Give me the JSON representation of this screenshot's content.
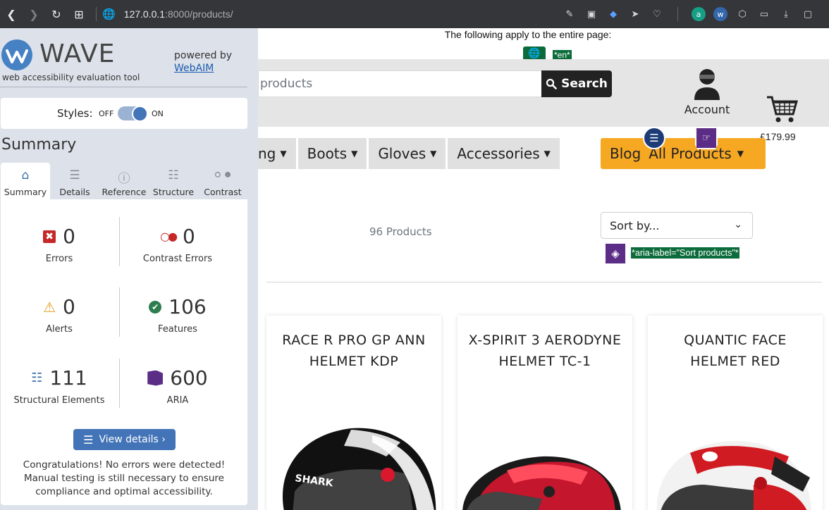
{
  "browser": {
    "url_host": "127.0.0.1",
    "url_path": ":8000/products/"
  },
  "wave_notice": {
    "text": "The following apply to the entire page:",
    "lang_tag": "*en*"
  },
  "site": {
    "search_placeholder": "products",
    "search_button": "Search",
    "account_label": "Account",
    "cart_total": "£179.99",
    "menu": [
      {
        "label": "ng"
      },
      {
        "label": "Boots"
      },
      {
        "label": "Gloves"
      },
      {
        "label": "Accessories"
      }
    ],
    "blog_label": "Blog",
    "all_products_label": "All Products",
    "product_count": "96 Products",
    "sort_label": "Sort by...",
    "sort_aria_tag": "*aria-label=\"Sort products\"*",
    "products": [
      {
        "title": "RACE R PRO GP ANN HELMET KDP"
      },
      {
        "title": "X-SPIRIT 3 AERODYNE HELMET TC-1"
      },
      {
        "title": "QUANTIC FACE HELMET RED"
      }
    ],
    "helmet_brand_text": "SHARK"
  },
  "wave": {
    "title": "WAVE",
    "subtitle": "web accessibility evaluation tool",
    "powered_by": "powered by",
    "webaim": "WebAIM",
    "styles_label": "Styles:",
    "styles_off": "OFF",
    "styles_on": "ON",
    "summary_heading": "Summary",
    "tabs": [
      {
        "label": "Summary",
        "icon": "home-icon"
      },
      {
        "label": "Details",
        "icon": "list-icon"
      },
      {
        "label": "Reference",
        "icon": "info-icon"
      },
      {
        "label": "Structure",
        "icon": "sitemap-icon"
      },
      {
        "label": "Contrast",
        "icon": "contrast-icon"
      }
    ],
    "stats": {
      "errors": {
        "value": "0",
        "label": "Errors"
      },
      "contrast_errors": {
        "value": "0",
        "label": "Contrast Errors"
      },
      "alerts": {
        "value": "0",
        "label": "Alerts"
      },
      "features": {
        "value": "106",
        "label": "Features"
      },
      "structural": {
        "value": "111",
        "label": "Structural Elements"
      },
      "aria": {
        "value": "600",
        "label": "ARIA"
      }
    },
    "view_details": "View details ›",
    "congrats": "Congratulations! No errors were detected! Manual testing is still necessary to ensure compliance and optimal accessibility."
  },
  "colors": {
    "wave_blue": "#4374b8",
    "wave_green_tag": "#0b6b3a",
    "wave_purple": "#5b2d86",
    "site_orange": "#f7a823"
  }
}
